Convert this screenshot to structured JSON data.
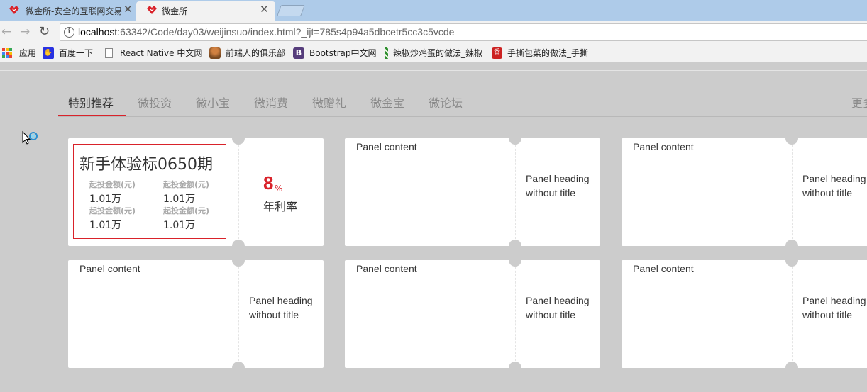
{
  "browser": {
    "tabs": [
      {
        "title": "微金所-安全的互联网交易平台",
        "close": "✕"
      },
      {
        "title": "微金所",
        "close": "✕"
      }
    ],
    "url_host": "localhost",
    "url_rest": ":63342/Code/day03/weijinsuo/index.html?_ijt=785s4p94a5dbcetr5cc3c5vcde",
    "bookmarks": [
      {
        "label": "应用",
        "icon": "apps-grid-icon"
      },
      {
        "label": "百度一下",
        "icon": "baidu-icon"
      },
      {
        "label": "React Native 中文网",
        "icon": "page-icon"
      },
      {
        "label": "前端人的俱乐部",
        "icon": "person-icon"
      },
      {
        "label": "Bootstrap中文网",
        "icon": "bootstrap-icon"
      },
      {
        "label": "辣椒炒鸡蛋的做法_辣椒",
        "icon": "recipe-icon"
      },
      {
        "label": "手撕包菜的做法_手撕",
        "icon": "recipe-red-icon"
      }
    ]
  },
  "nav": {
    "tabs": [
      "特别推荐",
      "微投资",
      "微小宝",
      "微消费",
      "微赠礼",
      "微金宝",
      "微论坛"
    ],
    "active_index": 0,
    "more": "更多"
  },
  "feature_card": {
    "title": "新手体验标0650期",
    "amounts": [
      {
        "label": "起投金额(元)",
        "value": "1.01万"
      },
      {
        "label": "起投金额(元)",
        "value": "1.01万"
      },
      {
        "label": "起投金额(元)",
        "value": "1.01万"
      },
      {
        "label": "起投金额(元)",
        "value": "1.01万"
      }
    ],
    "rate": "8",
    "rate_unit": "%",
    "rate_label": "年利率"
  },
  "panels": {
    "content": "Panel content",
    "heading": "Panel heading without title"
  },
  "colors": {
    "accent": "#d9222a",
    "page_bg": "#cccccc",
    "card_bg": "#ffffff"
  }
}
